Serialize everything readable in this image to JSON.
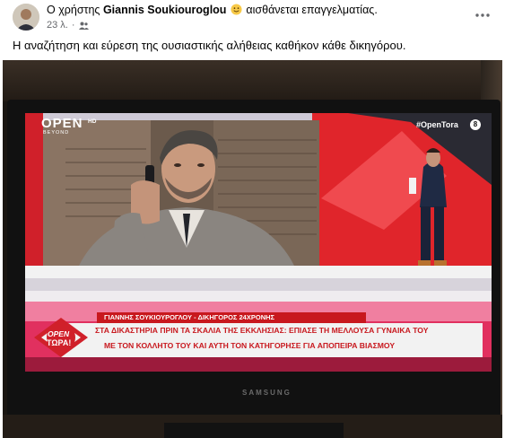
{
  "post": {
    "author_prefix": "Ο χρήστης",
    "author_name": "Giannis Soukiouroglou",
    "feeling": "αισθάνεται επαγγελματίας.",
    "time": "23 λ.",
    "text": "Η αναζήτηση και εύρεση της ουσιαστικής αλήθειας καθήκον κάθε δικηγόρου."
  },
  "tv": {
    "channel_logo": "OPEN",
    "channel_sub": "BEYOND",
    "channel_hd": "HD",
    "hashtag": "#OpenTora",
    "rating": "8",
    "show_logo_line1": "OPEN",
    "show_logo_line2": "ΤΩΡΑ!",
    "name_strip": "ΓΙΑΝΝΗΣ ΣΟΥΚΙΟΥΡΟΓΛΟΥ - ΔΙΚΗΓΟΡΟΣ 24ΧΡΟΝΗΣ",
    "headline_line1": "ΣΤΑ ΔΙΚΑΣΤΗΡΙΑ ΠΡΙΝ ΤΑ ΣΚΑΛΙΑ ΤΗΣ ΕΚΚΛΗΣΙΑΣ: ΕΠΙΑΣΕ ΤΗ ΜΕΛΛΟΥΣΑ ΓΥΝΑΙΚΑ ΤΟΥ",
    "headline_line2": "ΜΕ ΤΟΝ ΚΟΛΛΗΤΟ ΤΟΥ ΚΑΙ ΑΥΤΗ ΤΟΝ ΚΑΤΗΓΟΡΗΣΕ ΓΙΑ ΑΠΟΠΕΙΡΑ ΒΙΑΣΜΟΥ",
    "brand": "SAMSUNG"
  },
  "colors": {
    "studio_red": "#e0252b",
    "ticker_red": "#d0202a",
    "strip_red": "#c8181e",
    "caption_bar": "#f2f2f2"
  },
  "icons": {
    "emoji": "smiling-face-icon",
    "audience": "friends-icon",
    "more": "more-options-icon"
  }
}
